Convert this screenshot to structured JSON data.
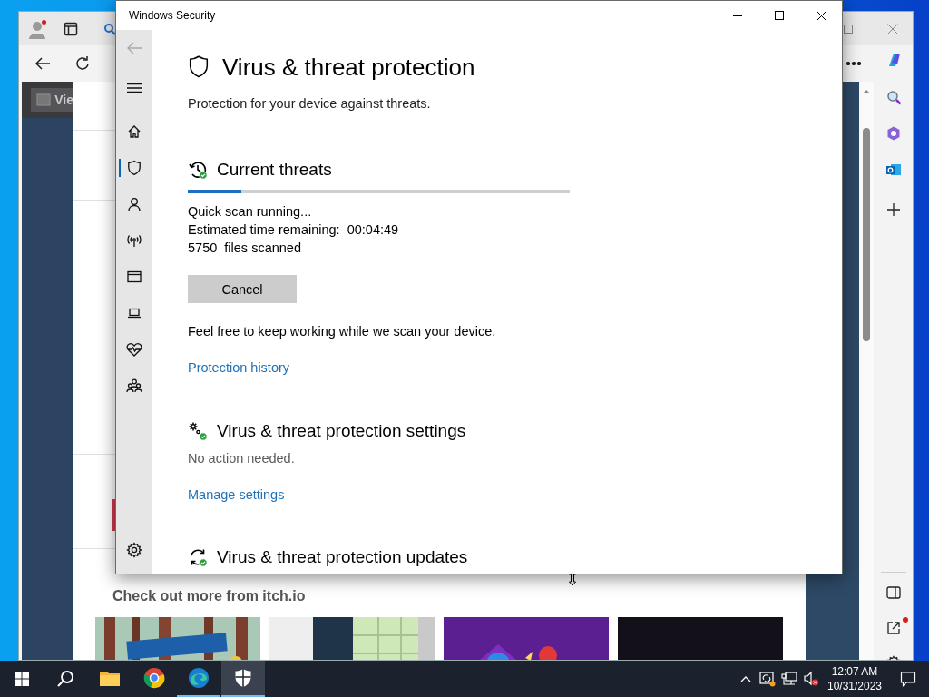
{
  "browser": {
    "page": {
      "button": "Vie",
      "heading": "Check out more from itch.io"
    }
  },
  "security": {
    "title": "Windows Security",
    "nav": [
      {
        "selected": false
      },
      {
        "selected": true
      },
      {
        "selected": false
      },
      {
        "selected": false
      },
      {
        "selected": false
      },
      {
        "selected": false
      },
      {
        "selected": false
      },
      {
        "selected": false
      }
    ],
    "settings_item": {
      "selected": false
    },
    "page_title": "Virus & threat protection",
    "subtitle": "Protection for your device against threats.",
    "sections": [
      {
        "kind": "scan",
        "title": "Current threats",
        "level": 0.14,
        "lines": [
          "Quick scan running...",
          "Estimated time remaining:  00:04:49",
          "5750  files scanned"
        ],
        "button": "Cancel",
        "note": "Feel free to keep working while we scan your device.",
        "link": "Protection history"
      },
      {
        "kind": "status",
        "title": "Virus & threat protection settings",
        "status": "No action needed.",
        "link": "Manage settings"
      },
      {
        "kind": "heading",
        "title": "Virus & threat protection updates"
      }
    ]
  },
  "taskbar": {
    "apps": [
      {
        "open": false,
        "selected": false
      },
      {
        "open": false,
        "selected": false
      },
      {
        "open": true,
        "selected": false
      },
      {
        "open": true,
        "selected": true
      }
    ],
    "time": "12:07 AM",
    "date": "10/31/2023"
  }
}
